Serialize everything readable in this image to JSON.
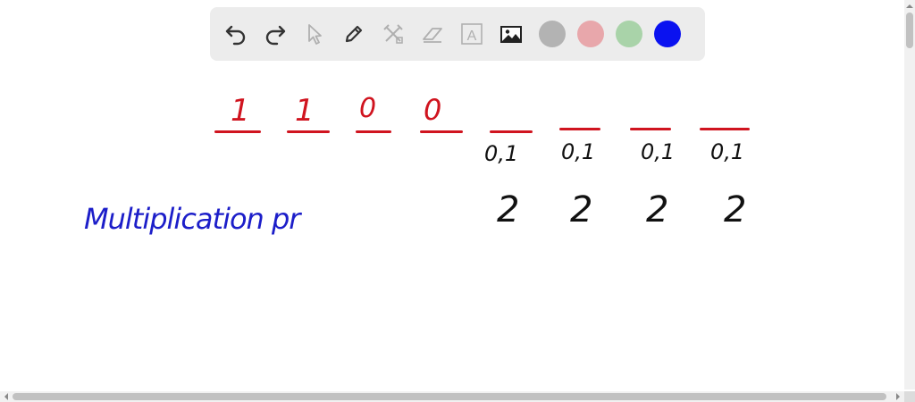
{
  "toolbar": {
    "tools": [
      {
        "name": "undo-icon"
      },
      {
        "name": "redo-icon"
      },
      {
        "name": "select-pointer-icon"
      },
      {
        "name": "pen-icon"
      },
      {
        "name": "tools-icon"
      },
      {
        "name": "eraser-icon"
      },
      {
        "name": "text-box-icon",
        "label": "A"
      },
      {
        "name": "image-icon"
      }
    ],
    "colors": [
      "#b3b3b3",
      "#e8a7ab",
      "#a9d3a9",
      "#0a12f0"
    ]
  },
  "whiteboard": {
    "top_digits": [
      "1",
      "1",
      "0",
      "0"
    ],
    "slot_labels": [
      "0,1",
      "0,1",
      "0,1",
      "0,1"
    ],
    "slot_counts": [
      "2",
      "2",
      "2",
      "2"
    ],
    "note": "Multiplication pr"
  }
}
